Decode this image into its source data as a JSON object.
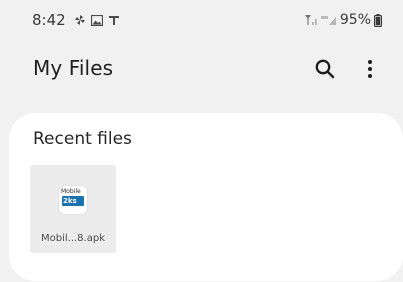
{
  "status_bar": {
    "time": "8:42",
    "left_icons": [
      "pinwheel-icon",
      "image-icon",
      "t-icon"
    ],
    "right_icons": [
      "signal-icon",
      "volte-icon",
      "battery-icon"
    ],
    "battery_percent": "95%"
  },
  "app_bar": {
    "title": "My Files",
    "actions": [
      "search-icon",
      "more-vertical-icon"
    ]
  },
  "recent_files": {
    "heading": "Recent files",
    "items": [
      {
        "thumbnail_text_top": "Mobile",
        "thumbnail_text_band": "2ks",
        "name": "Mobil...8.apk"
      }
    ]
  },
  "colors": {
    "background": "#f1f1f1",
    "card": "#ffffff",
    "tile": "#ececec",
    "thumbnail_band": "#1a73b0",
    "text_primary": "#1f1f1f"
  }
}
